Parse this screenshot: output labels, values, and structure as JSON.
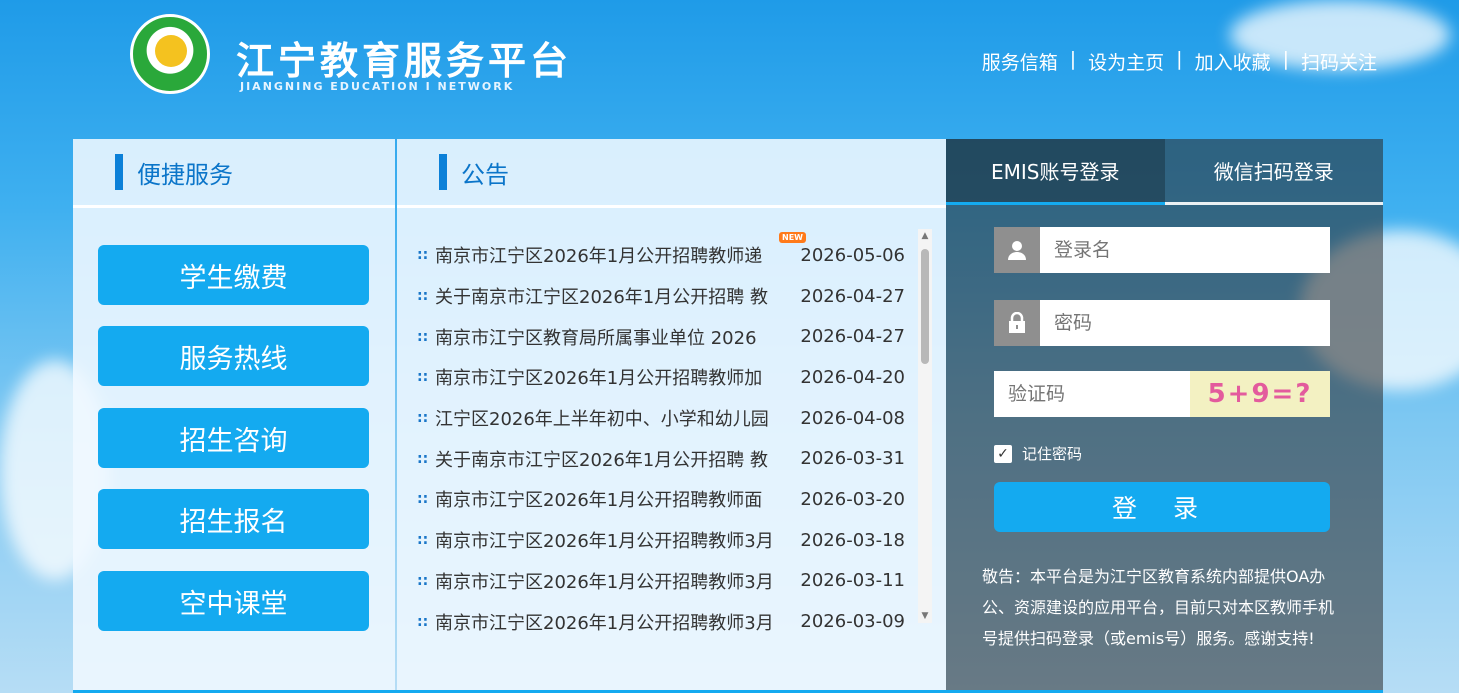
{
  "header": {
    "title": "江宁教育服务平台",
    "subtitle": "JIANGNING EDUCATION I NETWORK",
    "links": [
      "服务信箱",
      "设为主页",
      "加入收藏",
      "扫码关注"
    ],
    "separator": "|"
  },
  "quick_services": {
    "heading": "便捷服务",
    "buttons": [
      "学生缴费",
      "服务热线",
      "招生咨询",
      "招生报名",
      "空中课堂"
    ]
  },
  "announcements": {
    "heading": "公告",
    "new_badge": "NEW",
    "items": [
      {
        "title": "南京市江宁区2026年1月公开招聘教师递",
        "date": "2026-05-06"
      },
      {
        "title": "关于南京市江宁区2026年1月公开招聘 教",
        "date": "2026-04-27"
      },
      {
        "title": "南京市江宁区教育局所属事业单位 2026",
        "date": "2026-04-27"
      },
      {
        "title": "南京市江宁区2026年1月公开招聘教师加",
        "date": "2026-04-20"
      },
      {
        "title": "江宁区2026年上半年初中、小学和幼儿园",
        "date": "2026-04-08"
      },
      {
        "title": "关于南京市江宁区2026年1月公开招聘 教",
        "date": "2026-03-31"
      },
      {
        "title": "南京市江宁区2026年1月公开招聘教师面",
        "date": "2026-03-20"
      },
      {
        "title": "南京市江宁区2026年1月公开招聘教师3月",
        "date": "2026-03-18"
      },
      {
        "title": "南京市江宁区2026年1月公开招聘教师3月",
        "date": "2026-03-11"
      },
      {
        "title": "南京市江宁区2026年1月公开招聘教师3月",
        "date": "2026-03-09"
      }
    ]
  },
  "login": {
    "tabs": [
      "EMIS账号登录",
      "微信扫码登录"
    ],
    "username_placeholder": "登录名",
    "password_placeholder": "密码",
    "captcha_placeholder": "验证码",
    "captcha_text": "5+9=?",
    "remember_label": "记住密码",
    "submit_label": "登 录",
    "notice": "敬告：本平台是为江宁区教育系统内部提供OA办公、资源建设的应用平台，目前只对本区教师手机号提供扫码登录（或emis号）服务。感谢支持!"
  },
  "icons": {
    "user": "user-icon",
    "lock": "lock-icon",
    "check": "check-icon"
  },
  "colors": {
    "accent": "#14aaf0",
    "heading_text": "#0b75c9"
  }
}
